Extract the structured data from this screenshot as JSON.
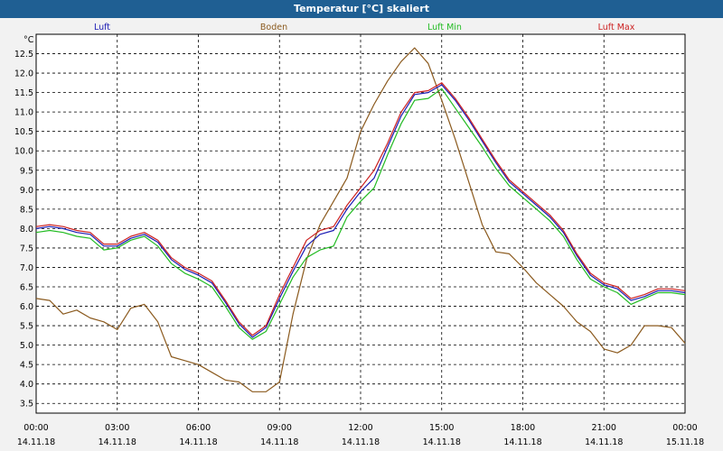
{
  "window": {
    "title": "Temperatur [°C] skaliert"
  },
  "chart_data": {
    "type": "line",
    "title": "Temperatur [°C] skaliert",
    "ylabel": "°C",
    "ylim": [
      3.25,
      13.0
    ],
    "yticks": [
      "3.5",
      "4.0",
      "4.5",
      "5.0",
      "5.5",
      "6.0",
      "6.5",
      "7.0",
      "7.5",
      "8.0",
      "8.5",
      "9.0",
      "9.5",
      "10.0",
      "10.5",
      "11.0",
      "11.5",
      "12.0",
      "12.5"
    ],
    "xlim": [
      0,
      24
    ],
    "xticks": [
      {
        "x": 0,
        "time": "00:00",
        "date": "14.11.18"
      },
      {
        "x": 3,
        "time": "03:00",
        "date": "14.11.18"
      },
      {
        "x": 6,
        "time": "06:00",
        "date": "14.11.18"
      },
      {
        "x": 9,
        "time": "09:00",
        "date": "14.11.18"
      },
      {
        "x": 12,
        "time": "12:00",
        "date": "14.11.18"
      },
      {
        "x": 15,
        "time": "15:00",
        "date": "14.11.18"
      },
      {
        "x": 18,
        "time": "18:00",
        "date": "14.11.18"
      },
      {
        "x": 21,
        "time": "21:00",
        "date": "14.11.18"
      },
      {
        "x": 24,
        "time": "00:00",
        "date": "15.11.18"
      }
    ],
    "grid": true,
    "legend": "top",
    "series": [
      {
        "name": "Luft",
        "color": "#1c1cb4",
        "x": [
          0,
          0.5,
          1,
          1.5,
          2,
          2.5,
          3,
          3.5,
          4,
          4.5,
          5,
          5.5,
          6,
          6.5,
          7,
          7.5,
          8,
          8.5,
          9,
          9.5,
          10,
          10.5,
          11,
          11.5,
          12,
          12.5,
          13,
          13.5,
          14,
          14.5,
          15,
          15.5,
          16,
          16.5,
          17,
          17.5,
          18,
          18.5,
          19,
          19.5,
          20,
          20.5,
          21,
          21.5,
          22,
          22.5,
          23,
          23.5,
          24
        ],
        "values": [
          8.0,
          8.05,
          8.0,
          7.9,
          7.85,
          7.55,
          7.55,
          7.75,
          7.85,
          7.65,
          7.2,
          6.95,
          6.8,
          6.6,
          6.1,
          5.55,
          5.2,
          5.45,
          6.2,
          6.9,
          7.55,
          7.85,
          7.95,
          8.5,
          8.95,
          9.3,
          10.1,
          10.9,
          11.45,
          11.5,
          11.7,
          11.3,
          10.8,
          10.25,
          9.7,
          9.2,
          8.9,
          8.6,
          8.3,
          7.9,
          7.3,
          6.8,
          6.55,
          6.45,
          6.15,
          6.25,
          6.4,
          6.4,
          6.35
        ]
      },
      {
        "name": "Boden",
        "color": "#8b5a1e",
        "x": [
          0,
          0.5,
          1,
          1.5,
          2,
          2.5,
          3,
          3.5,
          4,
          4.5,
          5,
          5.5,
          6,
          6.5,
          7,
          7.5,
          8,
          8.5,
          9,
          9.5,
          10,
          10.5,
          11,
          11.5,
          12,
          12.5,
          13,
          13.5,
          14,
          14.5,
          15,
          15.5,
          16,
          16.5,
          17,
          17.5,
          18,
          18.5,
          19,
          19.5,
          20,
          20.5,
          21,
          21.5,
          22,
          22.5,
          23,
          23.5,
          24
        ],
        "values": [
          6.2,
          6.15,
          5.8,
          5.9,
          5.7,
          5.6,
          5.4,
          5.95,
          6.05,
          5.6,
          4.7,
          4.6,
          4.5,
          4.3,
          4.1,
          4.05,
          3.8,
          3.8,
          4.05,
          5.8,
          7.2,
          8.1,
          8.7,
          9.3,
          10.5,
          11.2,
          11.8,
          12.3,
          12.65,
          12.25,
          11.3,
          10.3,
          9.2,
          8.1,
          7.4,
          7.35,
          7.0,
          6.6,
          6.3,
          6.0,
          5.6,
          5.35,
          4.9,
          4.8,
          5.0,
          5.5,
          5.5,
          5.45,
          5.05
        ]
      },
      {
        "name": "Luft Min",
        "color": "#22bb22",
        "x": [
          0,
          0.5,
          1,
          1.5,
          2,
          2.5,
          3,
          3.5,
          4,
          4.5,
          5,
          5.5,
          6,
          6.5,
          7,
          7.5,
          8,
          8.5,
          9,
          9.5,
          10,
          10.5,
          11,
          11.5,
          12,
          12.5,
          13,
          13.5,
          14,
          14.5,
          15,
          15.5,
          16,
          16.5,
          17,
          17.5,
          18,
          18.5,
          19,
          19.5,
          20,
          20.5,
          21,
          21.5,
          22,
          22.5,
          23,
          23.5,
          24
        ],
        "values": [
          7.9,
          7.95,
          7.9,
          7.8,
          7.75,
          7.45,
          7.5,
          7.7,
          7.8,
          7.55,
          7.1,
          6.85,
          6.7,
          6.5,
          6.0,
          5.45,
          5.15,
          5.35,
          6.05,
          6.75,
          7.25,
          7.45,
          7.55,
          8.3,
          8.7,
          9.05,
          9.9,
          10.7,
          11.3,
          11.35,
          11.6,
          11.1,
          10.6,
          10.1,
          9.55,
          9.1,
          8.8,
          8.5,
          8.2,
          7.8,
          7.2,
          6.7,
          6.5,
          6.35,
          6.05,
          6.2,
          6.35,
          6.35,
          6.3
        ]
      },
      {
        "name": "Luft Max",
        "color": "#cc2222",
        "x": [
          0,
          0.5,
          1,
          1.5,
          2,
          2.5,
          3,
          3.5,
          4,
          4.5,
          5,
          5.5,
          6,
          6.5,
          7,
          7.5,
          8,
          8.5,
          9,
          9.5,
          10,
          10.5,
          11,
          11.5,
          12,
          12.5,
          13,
          13.5,
          14,
          14.5,
          15,
          15.5,
          16,
          16.5,
          17,
          17.5,
          18,
          18.5,
          19,
          19.5,
          20,
          20.5,
          21,
          21.5,
          22,
          22.5,
          23,
          23.5,
          24
        ],
        "values": [
          8.05,
          8.1,
          8.05,
          7.95,
          7.9,
          7.6,
          7.6,
          7.8,
          7.9,
          7.7,
          7.25,
          7.0,
          6.85,
          6.65,
          6.15,
          5.6,
          5.25,
          5.5,
          6.3,
          7.0,
          7.7,
          7.95,
          8.05,
          8.6,
          9.05,
          9.5,
          10.2,
          11.0,
          11.5,
          11.55,
          11.75,
          11.35,
          10.85,
          10.3,
          9.75,
          9.25,
          8.95,
          8.65,
          8.35,
          7.95,
          7.35,
          6.85,
          6.6,
          6.5,
          6.2,
          6.3,
          6.45,
          6.45,
          6.4
        ]
      }
    ]
  }
}
